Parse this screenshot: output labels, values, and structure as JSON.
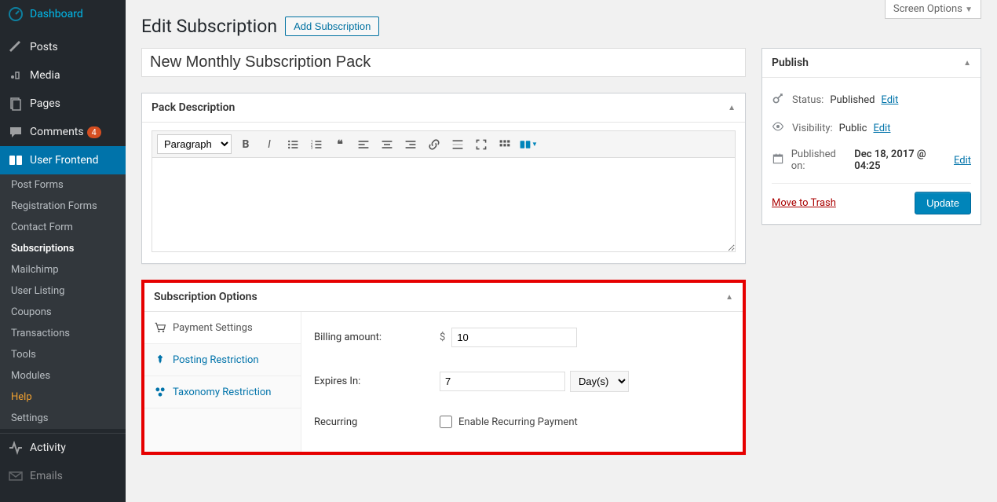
{
  "screen_options_label": "Screen Options",
  "page_title": "Edit Subscription",
  "add_button": "Add Subscription",
  "title_value": "New Monthly Subscription Pack",
  "sidebar": {
    "items": [
      {
        "icon": "dashboard",
        "label": "Dashboard"
      },
      {
        "icon": "pin",
        "label": "Posts"
      },
      {
        "icon": "media",
        "label": "Media"
      },
      {
        "icon": "pages",
        "label": "Pages"
      },
      {
        "icon": "comments",
        "label": "Comments",
        "badge": "4"
      },
      {
        "icon": "frontend",
        "label": "User Frontend",
        "active": true
      }
    ],
    "submenu": [
      {
        "label": "Post Forms"
      },
      {
        "label": "Registration Forms"
      },
      {
        "label": "Contact Form"
      },
      {
        "label": "Subscriptions",
        "current": true
      },
      {
        "label": "Mailchimp"
      },
      {
        "label": "User Listing"
      },
      {
        "label": "Coupons"
      },
      {
        "label": "Transactions"
      },
      {
        "label": "Tools"
      },
      {
        "label": "Modules"
      },
      {
        "label": "Help",
        "help": true
      },
      {
        "label": "Settings"
      }
    ],
    "after": [
      {
        "icon": "activity",
        "label": "Activity"
      },
      {
        "icon": "emails",
        "label": "Emails"
      }
    ]
  },
  "pack_description": {
    "title": "Pack Description",
    "paragraph_label": "Paragraph"
  },
  "subscription_options": {
    "title": "Subscription Options",
    "tabs": [
      {
        "icon": "cart",
        "label": "Payment Settings"
      },
      {
        "icon": "pin",
        "label": "Posting Restriction"
      },
      {
        "icon": "tax",
        "label": "Taxonomy Restriction"
      }
    ],
    "fields": {
      "billing_label": "Billing amount:",
      "billing_currency": "$",
      "billing_value": "10",
      "expires_label": "Expires In:",
      "expires_value": "7",
      "expires_unit": "Day(s)",
      "recurring_label": "Recurring",
      "recurring_checkbox_label": "Enable Recurring Payment"
    }
  },
  "publish": {
    "title": "Publish",
    "status_label": "Status:",
    "status_value": "Published",
    "visibility_label": "Visibility:",
    "visibility_value": "Public",
    "published_label": "Published on:",
    "published_value": "Dec 18, 2017 @ 04:25",
    "edit_label": "Edit",
    "trash_label": "Move to Trash",
    "update_label": "Update"
  }
}
